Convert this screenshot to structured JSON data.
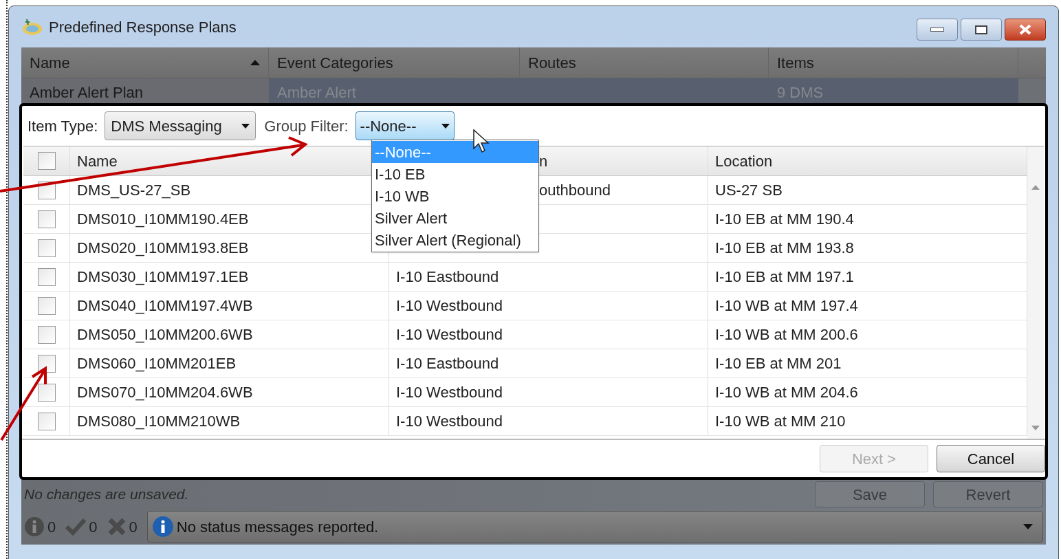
{
  "window": {
    "title": "Predefined Response Plans"
  },
  "plans_table": {
    "columns": [
      {
        "label": "Name",
        "sorted": true
      },
      {
        "label": "Event Categories",
        "sorted": false
      },
      {
        "label": "Routes",
        "sorted": false
      },
      {
        "label": "Items",
        "sorted": false
      }
    ],
    "rows": [
      {
        "name": "Amber Alert Plan",
        "event_categories": "Amber Alert",
        "items": "9 DMS",
        "selected": true
      }
    ]
  },
  "item_dialog": {
    "item_type": {
      "label": "Item Type:",
      "value": "DMS Messaging"
    },
    "group_filter": {
      "label": "Group Filter:",
      "value": "--None--",
      "open": true,
      "options": [
        {
          "label": "--None--",
          "selected": true
        },
        {
          "label": "I-10 EB",
          "selected": false
        },
        {
          "label": "I-10 WB",
          "selected": false
        },
        {
          "label": "Silver Alert",
          "selected": false
        },
        {
          "label": "Silver Alert (Regional)",
          "selected": false
        }
      ]
    },
    "select_all_checked": false,
    "columns": [
      {
        "label": "Name"
      },
      {
        "label": "n"
      },
      {
        "label": "Location"
      }
    ],
    "rows": [
      {
        "checked": false,
        "name": "DMS_US-27_SB",
        "column_2": "outhbound",
        "location": "US-27 SB"
      },
      {
        "checked": false,
        "name": "DMS010_I10MM190.4EB",
        "location": "I-10 EB at MM 190.4"
      },
      {
        "checked": false,
        "name": "DMS020_I10MM193.8EB",
        "location": "I-10 EB at MM 193.8"
      },
      {
        "checked": false,
        "name": "DMS030_I10MM197.1EB",
        "column_2": "I-10 Eastbound",
        "location": "I-10 EB at MM 197.1"
      },
      {
        "checked": false,
        "name": "DMS040_I10MM197.4WB",
        "column_2": "I-10 Westbound",
        "location": "I-10 WB at MM 197.4"
      },
      {
        "checked": false,
        "name": "DMS050_I10MM200.6WB",
        "column_2": "I-10 Westbound",
        "location": "I-10 WB at MM 200.6"
      },
      {
        "checked": false,
        "name": "DMS060_I10MM201EB",
        "column_2": "I-10 Eastbound",
        "location": "I-10 EB at MM 201"
      },
      {
        "checked": false,
        "name": "DMS070_I10MM204.6WB",
        "column_2": "I-10 Westbound",
        "location": "I-10 WB at MM 204.6"
      },
      {
        "checked": false,
        "name": "DMS080_I10MM210WB",
        "column_2": "I-10 Westbound",
        "location": "I-10 WB at MM 210"
      }
    ],
    "buttons": [
      {
        "label": "Next >",
        "disabled": true
      },
      {
        "label": "Cancel",
        "disabled": false
      }
    ]
  },
  "save_status": "No changes are unsaved.",
  "buttons": [
    {
      "label": "Save",
      "disabled": true
    },
    {
      "label": "Revert",
      "disabled": true
    }
  ],
  "status_bar": {
    "counts": [
      {
        "kind": "info",
        "count": "0"
      },
      {
        "kind": "success",
        "count": "0"
      },
      {
        "kind": "error",
        "count": "0"
      }
    ],
    "message": "No status messages reported."
  }
}
